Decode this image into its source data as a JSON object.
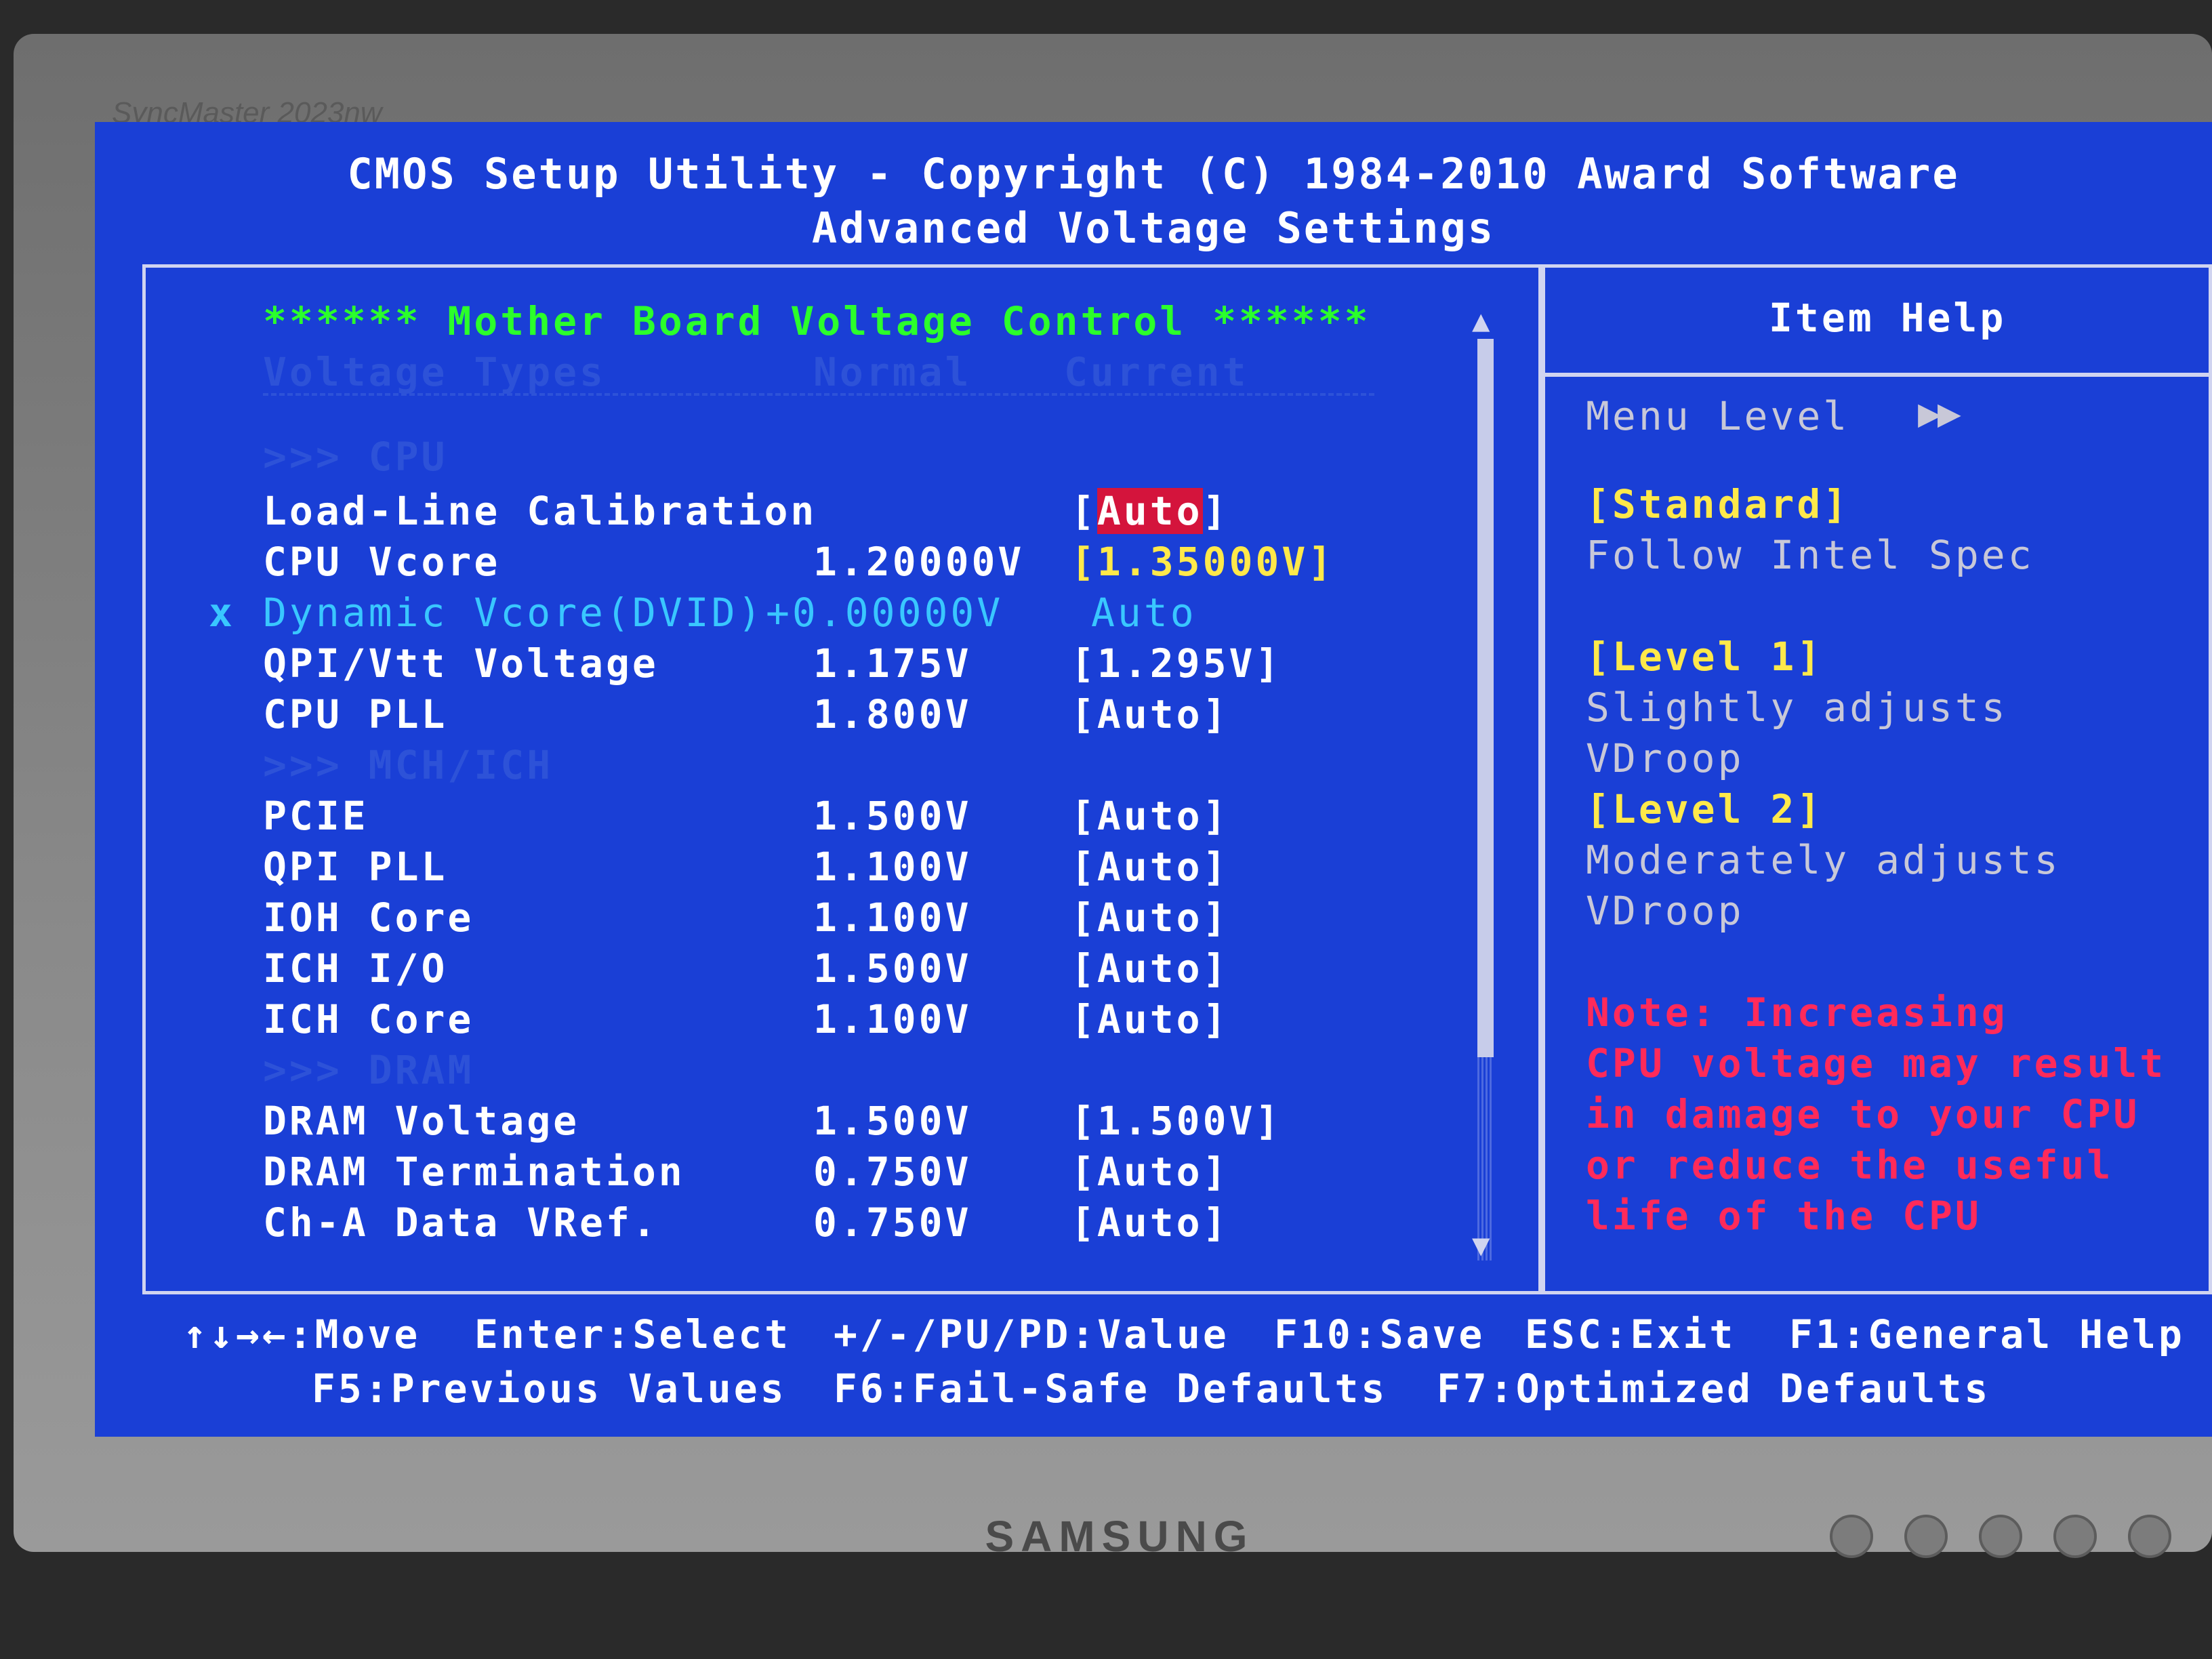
{
  "monitor": {
    "model": "SyncMaster 2023nw",
    "brand": "SAMSUNG"
  },
  "header": {
    "line1": "CMOS Setup Utility - Copyright (C) 1984-2010 Award Software",
    "line2": "Advanced Voltage Settings"
  },
  "section": {
    "title": "****** Mother Board Voltage Control ******",
    "col_type": "Voltage Types",
    "col_normal": "Normal",
    "col_current": "Current",
    "group_cpu": ">>> CPU",
    "group_mch": ">>> MCH/ICH",
    "group_dram": ">>> DRAM"
  },
  "items": [
    {
      "label": "Load-Line Calibration",
      "normal": "",
      "current_open": "[",
      "current": "Auto",
      "current_close": "]"
    },
    {
      "label": "CPU Vcore",
      "normal": "1.20000V",
      "current": "[1.35000V]"
    },
    {
      "marker": "x",
      "label": "Dynamic Vcore(DVID)",
      "normal": "+0.00000V",
      "current": "Auto"
    },
    {
      "label": "QPI/Vtt Voltage",
      "normal": "1.175V",
      "current": "[1.295V]"
    },
    {
      "label": "CPU PLL",
      "normal": "1.800V",
      "current": "[Auto]"
    },
    {
      "label": "PCIE",
      "normal": "1.500V",
      "current": "[Auto]"
    },
    {
      "label": "QPI PLL",
      "normal": "1.100V",
      "current": "[Auto]"
    },
    {
      "label": "IOH Core",
      "normal": "1.100V",
      "current": "[Auto]"
    },
    {
      "label": "ICH I/O",
      "normal": "1.500V",
      "current": "[Auto]"
    },
    {
      "label": "ICH Core",
      "normal": "1.100V",
      "current": "[Auto]"
    },
    {
      "label": "DRAM Voltage",
      "normal": "1.500V",
      "current": "[1.500V]"
    },
    {
      "label": "DRAM Termination",
      "normal": "0.750V",
      "current": "[Auto]"
    },
    {
      "label": "Ch-A Data VRef.",
      "normal": "0.750V",
      "current": "[Auto]"
    }
  ],
  "help": {
    "title": "Item Help",
    "menu_level": "Menu Level",
    "menu_level_arrows": "▶▶",
    "lines": [
      "[Standard]",
      "Follow Intel Spec",
      "[Level 1]",
      "Slightly adjusts",
      "VDroop",
      "[Level 2]",
      "Moderately adjusts",
      "VDroop"
    ],
    "note": [
      "Note: Increasing",
      "CPU voltage may result",
      "in damage to your CPU",
      "or reduce the useful",
      "life of the CPU"
    ]
  },
  "footer": {
    "move": "↑↓→←:Move",
    "select": "Enter:Select",
    "value": "+/-/PU/PD:Value",
    "save": "F10:Save",
    "exit": "ESC:Exit",
    "general_help": "F1:General Help",
    "prev_values": "F5:Previous Values",
    "failsafe": "F6:Fail-Safe Defaults",
    "optimized": "F7:Optimized Defaults"
  },
  "colors": {
    "screen_bg": "#1a3fd6",
    "item_text": "#ffffff",
    "section_title": "#2bff2b",
    "disabled_item": "#39c7ff",
    "selected_bg": "#d4143c",
    "help_option": "#ffe94a",
    "help_note": "#ff2a5a"
  }
}
